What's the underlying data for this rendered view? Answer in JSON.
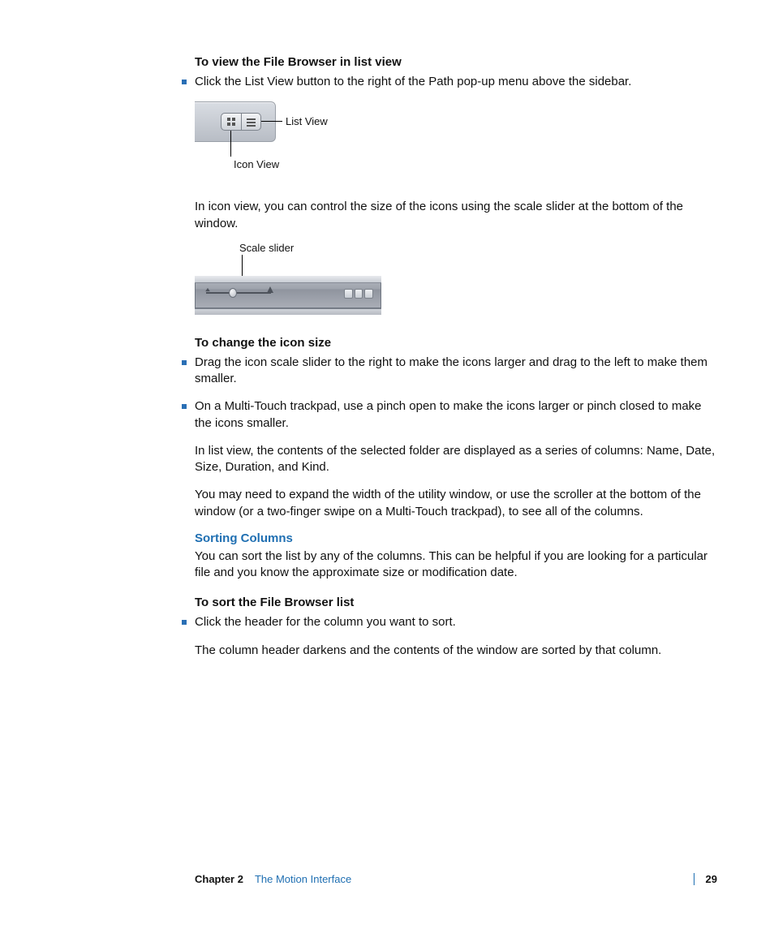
{
  "sections": [
    {
      "head1": "To view the File Browser in list view",
      "bullet1": "Click the List View button to the right of the Path pop-up menu above the sidebar."
    },
    {
      "fig1_listview": "List View",
      "fig1_iconview": "Icon View"
    },
    {
      "para1": "In icon view, you can control the size of the icons using the scale slider at the bottom of the window."
    },
    {
      "fig2_scale": "Scale slider"
    },
    {
      "head2": "To change the icon size",
      "bullet2": "Drag the icon scale slider to the right to make the icons larger and drag to the left to make them smaller.",
      "bullet3": "On a Multi-Touch trackpad, use a pinch open to make the icons larger or pinch closed to make the icons smaller.",
      "para2": "In list view, the contents of the selected folder are displayed as a series of columns: Name, Date, Size, Duration, and Kind.",
      "para3": "You may need to expand the width of the utility window, or use the scroller at the bottom of the window (or a two-finger swipe on a Multi-Touch trackpad), to see all of the columns."
    },
    {
      "bluehead": "Sorting Columns",
      "para4": "You can sort the list by any of the columns. This can be helpful if you are looking for a particular file and you know the approximate size or modification date."
    },
    {
      "head3": "To sort the File Browser list",
      "bullet4": "Click the header for the column you want to sort.",
      "para5": "The column header darkens and the contents of the window are sorted by that column."
    }
  ],
  "footer": {
    "chapter_label": "Chapter 2",
    "chapter_title": "The Motion Interface",
    "page_number": "29"
  }
}
